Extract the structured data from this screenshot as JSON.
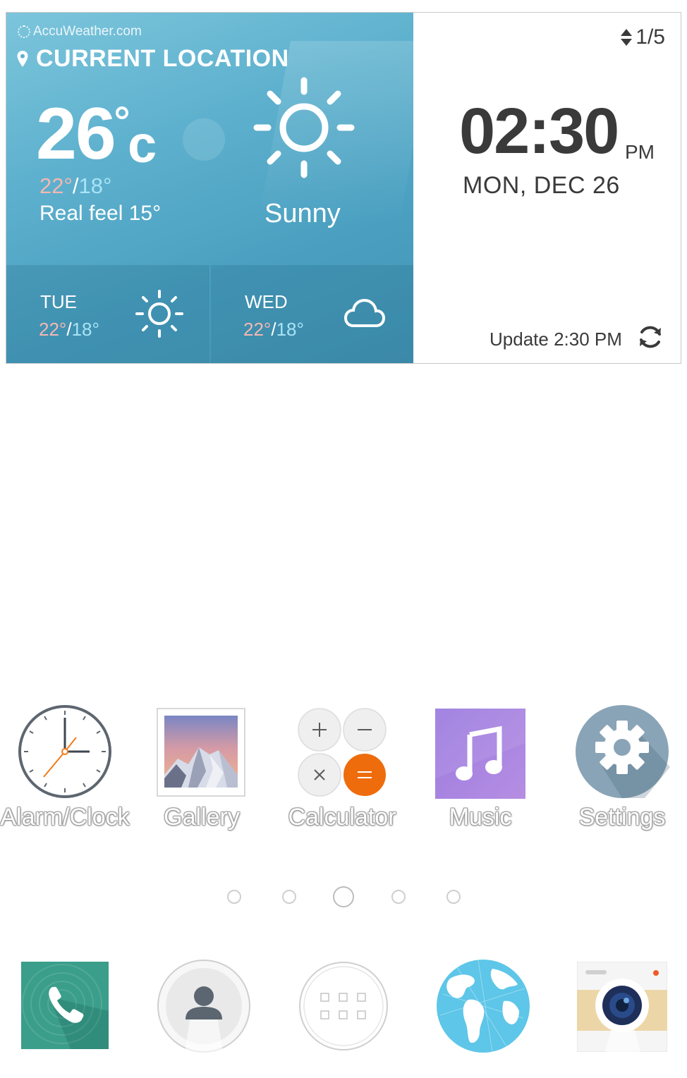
{
  "weather": {
    "provider": "AccuWeather.com",
    "location": "CURRENT LOCATION",
    "temperature": "26",
    "unit": "c",
    "high": "22°",
    "separator": "/",
    "low": "18°",
    "real_feel": "Real feel 15°",
    "condition": "Sunny",
    "icon": "sun-icon",
    "forecast": [
      {
        "day": "TUE",
        "high": "22°",
        "low": "18°",
        "icon": "sun-icon"
      },
      {
        "day": "WED",
        "high": "22°",
        "low": "18°",
        "icon": "cloud-icon"
      }
    ]
  },
  "clock": {
    "pager": "1/5",
    "time": "02:30",
    "ampm": "PM",
    "date": "MON, DEC 26",
    "update": "Update 2:30 PM"
  },
  "apps": [
    {
      "label": "Alarm/Clock",
      "icon": "clock-icon"
    },
    {
      "label": "Gallery",
      "icon": "gallery-icon"
    },
    {
      "label": "Calculator",
      "icon": "calculator-icon"
    },
    {
      "label": "Music",
      "icon": "music-icon"
    },
    {
      "label": "Settings",
      "icon": "gear-icon"
    }
  ],
  "page_indicator": {
    "count": 5,
    "active": 3
  },
  "dock": [
    {
      "icon": "phone-icon"
    },
    {
      "icon": "contacts-icon"
    },
    {
      "icon": "apps-grid-icon"
    },
    {
      "icon": "globe-icon"
    },
    {
      "icon": "camera-icon"
    }
  ],
  "colors": {
    "weather_bg": "#5eb1ce",
    "high_temp": "#f3b8b2",
    "low_temp": "#a9e3f5",
    "calc_equals": "#ee6c0c",
    "music_bg": "#a883dd",
    "settings_bg": "#8aa4b7",
    "phone_bg": "#3a9e8a"
  }
}
